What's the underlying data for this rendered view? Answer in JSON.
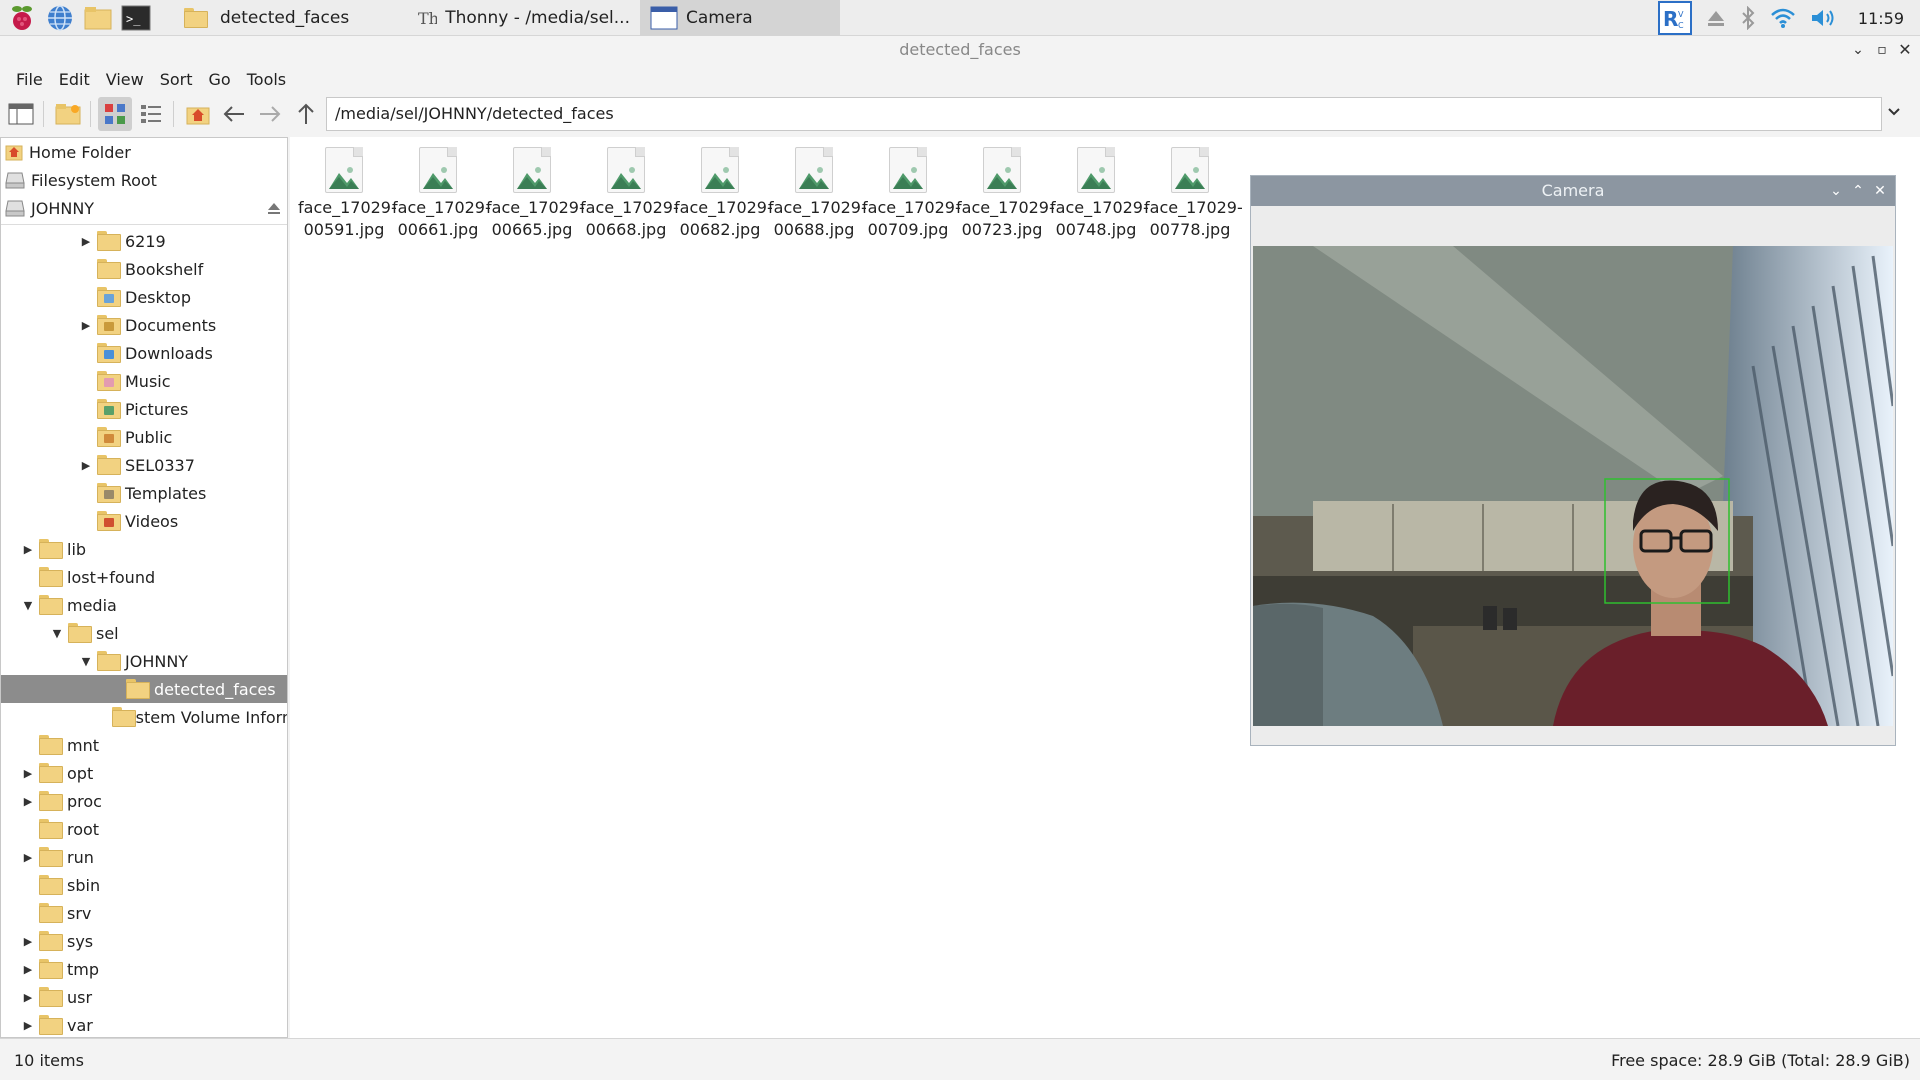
{
  "taskbar": {
    "tasks": [
      {
        "label": "detected_faces",
        "icon": "folder-icon"
      },
      {
        "label": "Thonny  -  /media/sel...",
        "icon": "thonny-icon"
      },
      {
        "label": "Camera",
        "icon": "window-icon",
        "active": true
      }
    ],
    "clock": "11:59"
  },
  "window": {
    "title": "detected_faces"
  },
  "menu": [
    "File",
    "Edit",
    "View",
    "Sort",
    "Go",
    "Tools"
  ],
  "path": "/media/sel/JOHNNY/detected_faces",
  "places": [
    {
      "label": "Home Folder",
      "icon": "home-icon"
    },
    {
      "label": "Filesystem Root",
      "icon": "drive-icon"
    },
    {
      "label": "JOHNNY",
      "icon": "drive-icon"
    }
  ],
  "tree": [
    {
      "label": "6219",
      "indent": 2,
      "expander": "right"
    },
    {
      "label": "Bookshelf",
      "indent": 2,
      "expander": ""
    },
    {
      "label": "Desktop",
      "indent": 2,
      "expander": ""
    },
    {
      "label": "Documents",
      "indent": 2,
      "expander": "right"
    },
    {
      "label": "Downloads",
      "indent": 2,
      "expander": ""
    },
    {
      "label": "Music",
      "indent": 2,
      "expander": ""
    },
    {
      "label": "Pictures",
      "indent": 2,
      "expander": ""
    },
    {
      "label": "Public",
      "indent": 2,
      "expander": ""
    },
    {
      "label": "SEL0337",
      "indent": 2,
      "expander": "right"
    },
    {
      "label": "Templates",
      "indent": 2,
      "expander": ""
    },
    {
      "label": "Videos",
      "indent": 2,
      "expander": ""
    },
    {
      "label": "lib",
      "indent": 0,
      "expander": "right"
    },
    {
      "label": "lost+found",
      "indent": 0,
      "expander": ""
    },
    {
      "label": "media",
      "indent": 0,
      "expander": "down"
    },
    {
      "label": "sel",
      "indent": 1,
      "expander": "down"
    },
    {
      "label": "JOHNNY",
      "indent": 2,
      "expander": "down"
    },
    {
      "label": "detected_faces",
      "indent": 3,
      "expander": "",
      "selected": true
    },
    {
      "label": "System Volume Information",
      "indent": 3,
      "expander": ""
    },
    {
      "label": "mnt",
      "indent": 0,
      "expander": ""
    },
    {
      "label": "opt",
      "indent": 0,
      "expander": "right"
    },
    {
      "label": "proc",
      "indent": 0,
      "expander": "right"
    },
    {
      "label": "root",
      "indent": 0,
      "expander": ""
    },
    {
      "label": "run",
      "indent": 0,
      "expander": "right"
    },
    {
      "label": "sbin",
      "indent": 0,
      "expander": ""
    },
    {
      "label": "srv",
      "indent": 0,
      "expander": ""
    },
    {
      "label": "sys",
      "indent": 0,
      "expander": "right"
    },
    {
      "label": "tmp",
      "indent": 0,
      "expander": "right"
    },
    {
      "label": "usr",
      "indent": 0,
      "expander": "right"
    },
    {
      "label": "var",
      "indent": 0,
      "expander": "right"
    }
  ],
  "files": [
    {
      "line1": "face_17029-",
      "line2": "00591.jpg"
    },
    {
      "line1": "face_17029-",
      "line2": "00661.jpg"
    },
    {
      "line1": "face_17029-",
      "line2": "00665.jpg"
    },
    {
      "line1": "face_17029-",
      "line2": "00668.jpg"
    },
    {
      "line1": "face_17029-",
      "line2": "00682.jpg"
    },
    {
      "line1": "face_17029-",
      "line2": "00688.jpg"
    },
    {
      "line1": "face_17029-",
      "line2": "00709.jpg"
    },
    {
      "line1": "face_17029-",
      "line2": "00723.jpg"
    },
    {
      "line1": "face_17029-",
      "line2": "00748.jpg"
    },
    {
      "line1": "face_17029-",
      "line2": "00778.jpg"
    }
  ],
  "status": {
    "items": "10 items",
    "free": "Free space: 28.9 GiB (Total: 28.9 GiB)"
  },
  "camera": {
    "title": "Camera"
  },
  "colors": {
    "selection": "#8c8c8c",
    "detection_box": "#2fbf2f",
    "folder": "#f2d281"
  }
}
